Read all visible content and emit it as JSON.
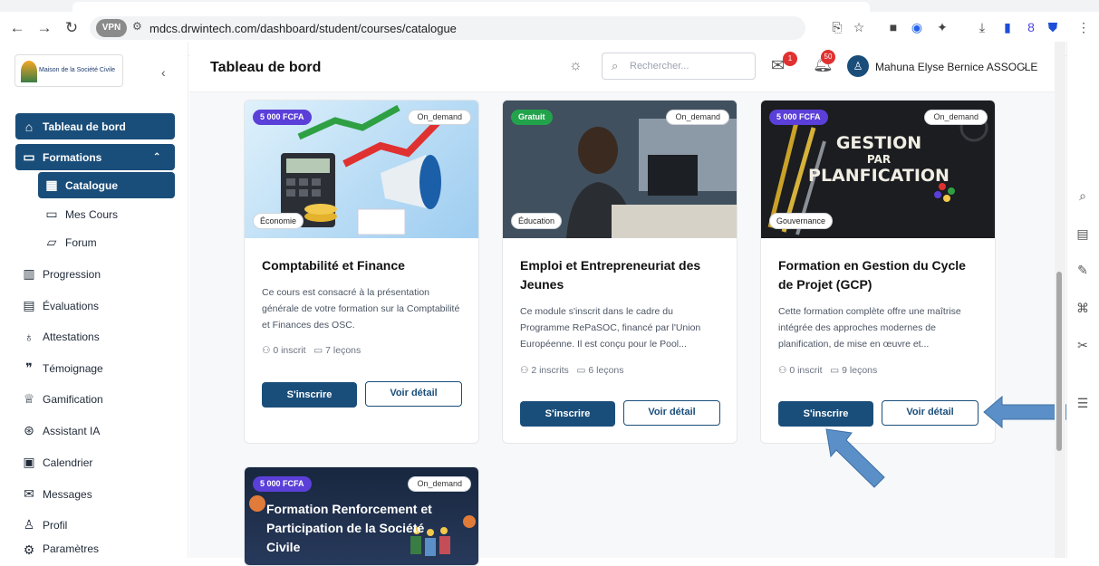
{
  "browser": {
    "url": "mdcs.drwintech.com/dashboard/student/courses/catalogue",
    "vpn_label": "VPN"
  },
  "sidebar": {
    "logo_text": "Maison de la Société Civile",
    "items": [
      {
        "label": "Tableau de bord",
        "icon": "home-icon"
      },
      {
        "label": "Formations",
        "icon": "book-icon"
      },
      {
        "label": "Catalogue",
        "icon": "grid-icon"
      },
      {
        "label": "Mes Cours",
        "icon": "book-icon"
      },
      {
        "label": "Forum",
        "icon": "chat-icon"
      },
      {
        "label": "Progression",
        "icon": "bar-chart-icon"
      },
      {
        "label": "Évaluations",
        "icon": "document-icon"
      },
      {
        "label": "Attestations",
        "icon": "award-icon"
      },
      {
        "label": "Témoignage",
        "icon": "quote-icon"
      },
      {
        "label": "Gamification",
        "icon": "trophy-icon"
      },
      {
        "label": "Assistant IA",
        "icon": "brain-icon"
      },
      {
        "label": "Calendrier",
        "icon": "calendar-icon"
      },
      {
        "label": "Messages",
        "icon": "mail-icon"
      },
      {
        "label": "Profil",
        "icon": "user-icon"
      },
      {
        "label": "Paramètres",
        "icon": "settings-icon"
      }
    ]
  },
  "header": {
    "title": "Tableau de bord",
    "search_placeholder": "Rechercher...",
    "mail_badge": "1",
    "bell_badge": "50",
    "user_name": "Mahuna Elyse Bernice ASSOCLE"
  },
  "courses": [
    {
      "price": "5 000 FCFA",
      "mode": "On_demand",
      "category": "Économie",
      "title": "Comptabilité et Finance",
      "description": "Ce cours est consacré à la présentation générale de votre formation sur la Comptabilité et Finances des OSC.",
      "enrolled": "0 inscrit",
      "lessons": "7 leçons",
      "enroll_label": "S'inscrire",
      "detail_label": "Voir détail"
    },
    {
      "price": "Gratuit",
      "mode": "On_demand",
      "category": "Éducation",
      "title": "Emploi et Entrepreneuriat des Jeunes",
      "description": "Ce module s'inscrit dans le cadre du Programme RePaSOC, financé par l'Union Européenne. Il est conçu pour le Pool...",
      "enrolled": "2 inscrits",
      "lessons": "6 leçons",
      "enroll_label": "S'inscrire",
      "detail_label": "Voir détail"
    },
    {
      "price": "5 000 FCFA",
      "mode": "On_demand",
      "category": "Gouvernance",
      "title": "Formation en Gestion du Cycle de Projet (GCP)",
      "description": "Cette formation complète offre une maîtrise intégrée des approches modernes de planification, de mise en œuvre et...",
      "enrolled": "0 inscrit",
      "lessons": "9 leçons",
      "enroll_label": "S'inscrire",
      "detail_label": "Voir détail",
      "image_text": [
        "GESTION",
        "PAR",
        "PLANFICATION"
      ]
    },
    {
      "price": "5 000 FCFA",
      "mode": "On_demand",
      "image_text": "Formation Renforcement et Participation de la Société Civile"
    }
  ],
  "colors": {
    "primary": "#1a4e7a",
    "price_badge": "#5b3fd9",
    "free_badge": "#22a34b",
    "notification": "#e03131",
    "annotation_arrow": "#5b8fc7"
  }
}
